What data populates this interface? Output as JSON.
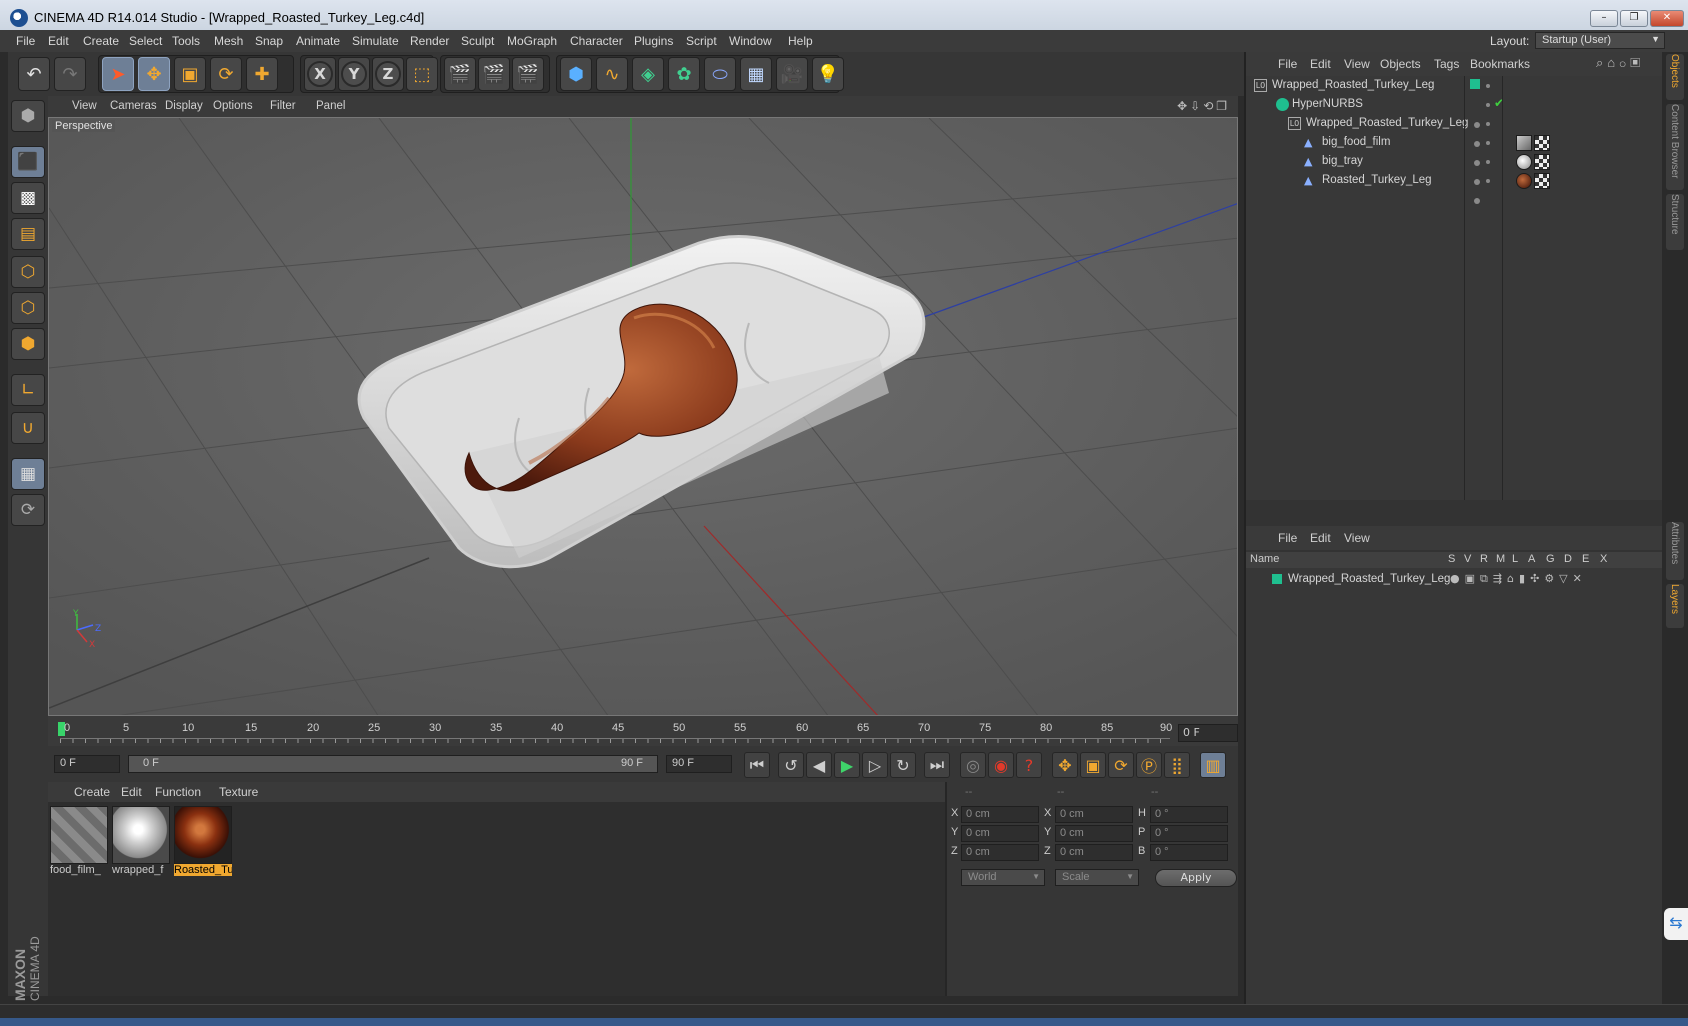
{
  "window": {
    "title": "CINEMA 4D R14.014 Studio - [Wrapped_Roasted_Turkey_Leg.c4d]",
    "controls": [
      "–",
      "❐",
      "✕"
    ]
  },
  "menubar": {
    "items": [
      "File",
      "Edit",
      "Create",
      "Select",
      "Tools",
      "Mesh",
      "Snap",
      "Animate",
      "Simulate",
      "Render",
      "Sculpt",
      "MoGraph",
      "Character",
      "Plugins",
      "Script",
      "Window",
      "Help"
    ],
    "layout_label": "Layout:",
    "layout_value": "Startup (User)"
  },
  "toolbar": {
    "undo": "undo-icon",
    "redo": "redo-icon",
    "axis_x": "X",
    "axis_y": "Y",
    "axis_z": "Z"
  },
  "viewport": {
    "menu": [
      "View",
      "Cameras",
      "Display",
      "Options",
      "Filter",
      "Panel"
    ],
    "label": "Perspective",
    "axis_labels": {
      "y": "Y",
      "z": "Z",
      "x": "X"
    }
  },
  "timeline": {
    "ticks": [
      "0",
      "5",
      "10",
      "15",
      "20",
      "25",
      "30",
      "35",
      "40",
      "45",
      "50",
      "55",
      "60",
      "65",
      "70",
      "75",
      "80",
      "85",
      "90"
    ],
    "current_frame": "0 F",
    "start_field": "0 F",
    "range_start": "0 F",
    "range_end": "90 F",
    "end_field": "90 F"
  },
  "materials": {
    "menu": [
      "Create",
      "Edit",
      "Function",
      "Texture"
    ],
    "items": [
      {
        "name": "food_film_",
        "selected": false
      },
      {
        "name": "wrapped_f",
        "selected": false
      },
      {
        "name": "Roasted_Tu",
        "selected": true
      }
    ]
  },
  "coordinates": {
    "headers": [
      "--",
      "--",
      "--"
    ],
    "rows": [
      {
        "label1": "X",
        "val1": "0 cm",
        "label2": "X",
        "val2": "0 cm",
        "label3": "H",
        "val3": "0 °"
      },
      {
        "label1": "Y",
        "val1": "0 cm",
        "label2": "Y",
        "val2": "0 cm",
        "label3": "P",
        "val3": "0 °"
      },
      {
        "label1": "Z",
        "val1": "0 cm",
        "label2": "Z",
        "val2": "0 cm",
        "label3": "B",
        "val3": "0 °"
      }
    ],
    "world": "World",
    "scale": "Scale",
    "apply": "Apply"
  },
  "objects_panel": {
    "menu": [
      "File",
      "Edit",
      "View",
      "Objects",
      "Tags",
      "Bookmarks"
    ],
    "rows": [
      {
        "name": "Wrapped_Roasted_Turkey_Leg",
        "indent": 0,
        "type": "null"
      },
      {
        "name": "HyperNURBS",
        "indent": 1,
        "type": "nurbs"
      },
      {
        "name": "Wrapped_Roasted_Turkey_Leg",
        "indent": 2,
        "type": "null"
      },
      {
        "name": "big_food_film",
        "indent": 3,
        "type": "mesh"
      },
      {
        "name": "big_tray",
        "indent": 3,
        "type": "mesh"
      },
      {
        "name": "Roasted_Turkey_Leg",
        "indent": 3,
        "type": "mesh"
      }
    ]
  },
  "layers_panel": {
    "menu": [
      "File",
      "Edit",
      "View"
    ],
    "columns": [
      "Name",
      "S",
      "V",
      "R",
      "M",
      "L",
      "A",
      "G",
      "D",
      "E",
      "X"
    ],
    "rows": [
      {
        "name": "Wrapped_Roasted_Turkey_Leg",
        "color": "#1fbf8f"
      }
    ]
  },
  "side_tabs": [
    "Objects",
    "Content Browser",
    "Structure",
    "Attributes",
    "Layers"
  ],
  "logo": {
    "line1": "MAXON",
    "line2": "CINEMA 4D"
  },
  "colors": {
    "accent": "#f0a830",
    "layer": "#1fbf8f",
    "active_button": "#6e7f96"
  }
}
